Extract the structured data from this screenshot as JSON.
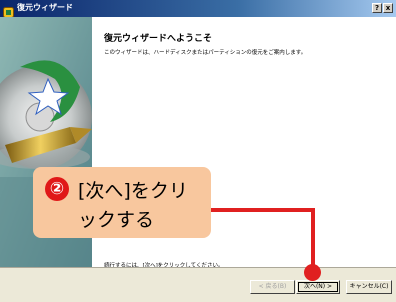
{
  "window": {
    "title": "復元ウィザード",
    "help_label": "?",
    "close_label": "x"
  },
  "content": {
    "heading": "復元ウィザードへようこそ",
    "description": "このウィザードは、ハードディスクまたはパーティションの復元をご案内します。",
    "instruction": "続行するには、[次へ]をクリックしてください。"
  },
  "buttons": {
    "back": "< 戻る(B)",
    "next": "次へ(N) >",
    "cancel": "キャンセル(C)"
  },
  "annotation": {
    "step_number": "②",
    "line1": "[次へ]をクリ",
    "line2": "ックする"
  },
  "colors": {
    "annotation_red": "#e02020",
    "callout_bg": "#f8c79e",
    "titlebar": "#0a246a"
  },
  "icons": {
    "title": "app-icon",
    "side": "wizard-graphic"
  }
}
